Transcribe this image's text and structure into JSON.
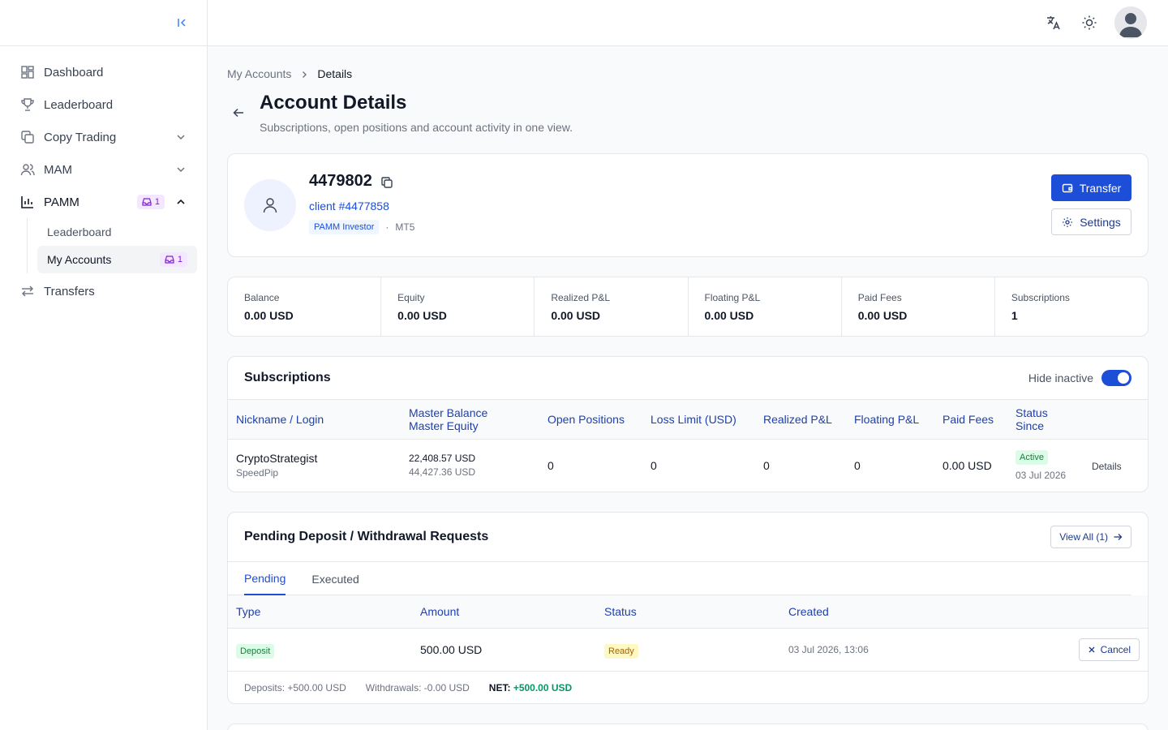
{
  "sidebar": {
    "items": [
      {
        "label": "Dashboard"
      },
      {
        "label": "Leaderboard"
      },
      {
        "label": "Copy Trading"
      },
      {
        "label": "MAM"
      },
      {
        "label": "PAMM",
        "badge": "1"
      },
      {
        "label": "Transfers"
      }
    ],
    "pamm_sub": [
      {
        "label": "Leaderboard"
      },
      {
        "label": "My Accounts",
        "badge": "1"
      }
    ]
  },
  "breadcrumb": {
    "parent": "My Accounts",
    "current": "Details"
  },
  "header": {
    "title": "Account Details",
    "subtitle": "Subscriptions, open positions and account activity in one view."
  },
  "account": {
    "number": "4479802",
    "client": "client #4477858",
    "type": "PAMM Investor",
    "dot": "·",
    "platform": "MT5",
    "transfer_label": "Transfer",
    "settings_label": "Settings"
  },
  "stats": [
    {
      "label": "Balance",
      "value": "0.00 USD"
    },
    {
      "label": "Equity",
      "value": "0.00 USD"
    },
    {
      "label": "Realized P&L",
      "value": "0.00 USD"
    },
    {
      "label": "Floating P&L",
      "value": "0.00 USD"
    },
    {
      "label": "Paid Fees",
      "value": "0.00 USD"
    },
    {
      "label": "Subscriptions",
      "value": "1"
    }
  ],
  "subscriptions": {
    "title": "Subscriptions",
    "hide_inactive": "Hide inactive",
    "columns": {
      "nickname": "Nickname / Login",
      "master_balance": "Master Balance",
      "master_equity": "Master Equity",
      "open_positions": "Open Positions",
      "loss_limit": "Loss Limit (USD)",
      "realized": "Realized P&L",
      "floating": "Floating P&L",
      "fees": "Paid Fees",
      "status": "Status",
      "since": "Since"
    },
    "rows": [
      {
        "nickname": "CryptoStrategist",
        "login": "SpeedPip",
        "balance": "22,408.57 USD",
        "equity": "44,427.36 USD",
        "open_positions": "0",
        "loss_limit": "0",
        "realized": "0",
        "floating": "0",
        "fees": "0.00 USD",
        "status": "Active",
        "since": "03 Jul 2026",
        "action": "Details"
      }
    ]
  },
  "pending": {
    "title": "Pending Deposit / Withdrawal Requests",
    "view_all": "View All (1)",
    "tabs": [
      "Pending",
      "Executed"
    ],
    "columns": {
      "type": "Type",
      "amount": "Amount",
      "status": "Status",
      "created": "Created"
    },
    "rows": [
      {
        "type": "Deposit",
        "amount": "500.00 USD",
        "status": "Ready",
        "created": "03 Jul 2026, 13:06",
        "action": "Cancel"
      }
    ],
    "summary": {
      "deposits": "Deposits: +500.00 USD",
      "withdrawals": "Withdrawals: -0.00 USD",
      "net_label": "NET:",
      "net_value": "+500.00 USD"
    }
  }
}
